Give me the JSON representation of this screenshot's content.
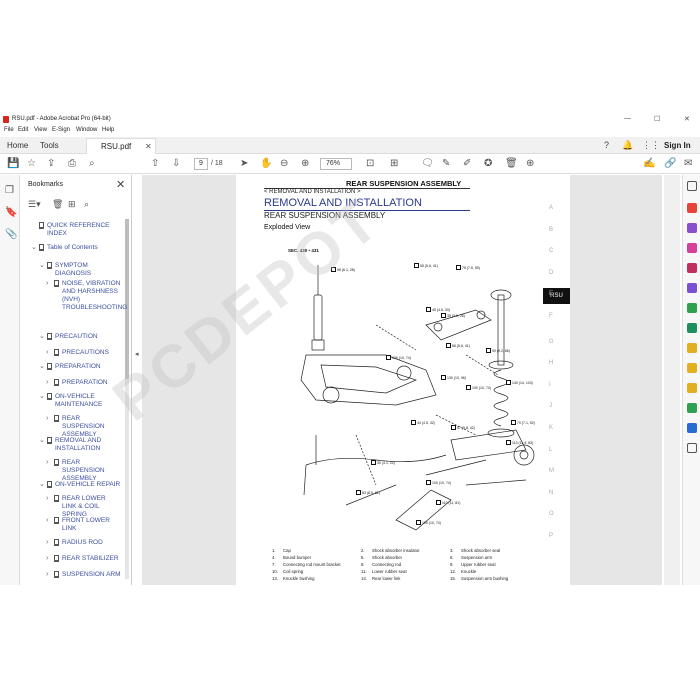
{
  "window": {
    "title": "RSU.pdf - Adobe Acrobat Pro (64-bit)"
  },
  "menu": [
    "File",
    "Edit",
    "View",
    "E-Sign",
    "Window",
    "Help"
  ],
  "tabs": {
    "home": "Home",
    "tools": "Tools",
    "document": "RSU.pdf",
    "sign_in": "Sign In"
  },
  "toolbar": {
    "page_current": "9",
    "page_total": "/ 18",
    "zoom": "76%"
  },
  "bookmarks": {
    "header": "Bookmarks",
    "items": [
      {
        "label": "QUICK REFERENCE INDEX",
        "level": 0,
        "expander": ""
      },
      {
        "label": "Table of Contents",
        "level": 0,
        "expander": "⌄"
      },
      {
        "label": "SYMPTOM DIAGNOSIS",
        "level": 1,
        "expander": "⌄"
      },
      {
        "label": "NOISE, VIBRATION AND HARSHNESS (NVH) TROUBLESHOOTING",
        "level": 2,
        "expander": "›"
      },
      {
        "label": "PRECAUTION",
        "level": 1,
        "expander": "⌄"
      },
      {
        "label": "PRECAUTIONS",
        "level": 2,
        "expander": "›"
      },
      {
        "label": "PREPARATION",
        "level": 1,
        "expander": "⌄"
      },
      {
        "label": "PREPARATION",
        "level": 2,
        "expander": "›"
      },
      {
        "label": "ON-VEHICLE MAINTENANCE",
        "level": 1,
        "expander": "⌄"
      },
      {
        "label": "REAR SUSPENSION ASSEMBLY",
        "level": 2,
        "expander": "›"
      },
      {
        "label": "REMOVAL AND INSTALLATION",
        "level": 1,
        "expander": "⌄"
      },
      {
        "label": "REAR SUSPENSION ASSEMBLY",
        "level": 2,
        "expander": "›"
      },
      {
        "label": "ON-VEHICLE REPAIR",
        "level": 1,
        "expander": "⌄"
      },
      {
        "label": "REAR LOWER LINK & COIL SPRING",
        "level": 2,
        "expander": "›"
      },
      {
        "label": "FRONT LOWER LINK",
        "level": 2,
        "expander": "›"
      },
      {
        "label": "RADIUS ROD",
        "level": 2,
        "expander": "›"
      },
      {
        "label": "REAR STABILIZER",
        "level": 2,
        "expander": "›"
      },
      {
        "label": "SUSPENSION ARM",
        "level": 2,
        "expander": "›"
      }
    ]
  },
  "page": {
    "section_header": "REAR SUSPENSION ASSEMBLY",
    "breadcrumb": "< REMOVAL AND INSTALLATION >",
    "heading1": "REMOVAL AND INSTALLATION",
    "heading2": "REAR SUSPENSION ASSEMBLY",
    "heading3": "Exploded View",
    "sec": "SEC. 430 • 431",
    "tab_label": "RSU",
    "index_letters": [
      "A",
      "B",
      "C",
      "D",
      "E",
      "F",
      "G",
      "H",
      "I",
      "J",
      "K",
      "L",
      "M",
      "N",
      "O",
      "P"
    ],
    "legend": [
      [
        "1.",
        "Cap",
        "2.",
        "Shock absorber insulator",
        "3.",
        "Shock absorber seal"
      ],
      [
        "4.",
        "Bound bumper",
        "5.",
        "Shock absorber",
        "6.",
        "Suspension arm"
      ],
      [
        "7.",
        "Connecting rod mount bracket",
        "8.",
        "Connecting rod",
        "9.",
        "Upper rubber seat"
      ],
      [
        "10.",
        "Coil spring",
        "11.",
        "Lower rubber seat",
        "12.",
        "Knuckle"
      ],
      [
        "13.",
        "Knuckle bushing",
        "14.",
        "Rear lower link",
        "15.",
        "Suspension arm bushing"
      ]
    ],
    "callouts": [
      "98 (6.1, 28)",
      "55 (5.6, 41)",
      "75 (7.6, 55)",
      "45 (4.6, 33)",
      "35 (3.6, 26)",
      "56 (5.6, 41)",
      "90 (9.2, 66)",
      "100 (10, 74)",
      "130 (13, 96)",
      "100 (10, 74)",
      "140 (14, 103)",
      "70 (7.1, 52)",
      "44 (4.5, 32)",
      "57 (5.8, 42)",
      "113 (11.5, 83)",
      "30 (3.1, 22)",
      "100 (10, 74)",
      "110 (11, 81)",
      "83 (8.5, 61)",
      "100 (10, 74)"
    ]
  },
  "colors": {
    "link": "#3b4fa0",
    "heading": "#2b3b8f",
    "pdf_red": "#d7261e"
  }
}
